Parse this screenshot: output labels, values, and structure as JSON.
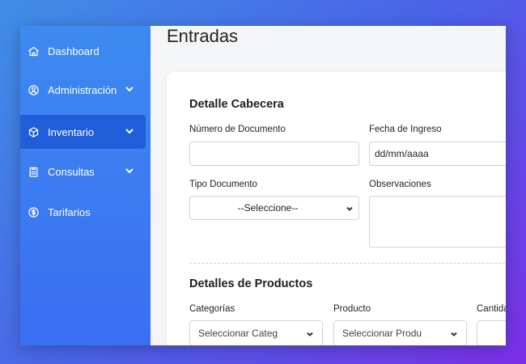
{
  "sidebar": {
    "items": [
      {
        "label": "Dashboard",
        "icon": "home-icon",
        "has_submenu": false,
        "active": false
      },
      {
        "label": "Administración",
        "icon": "user-circle-icon",
        "has_submenu": true,
        "active": false
      },
      {
        "label": "Inventario",
        "icon": "box-icon",
        "has_submenu": true,
        "active": true
      },
      {
        "label": "Consultas",
        "icon": "clipboard-icon",
        "has_submenu": true,
        "active": false
      },
      {
        "label": "Tarifarios",
        "icon": "dollar-circle-icon",
        "has_submenu": false,
        "active": false
      }
    ]
  },
  "main": {
    "title": "Entradas",
    "header_section": {
      "title": "Detalle Cabecera",
      "doc_number_label": "Número de Documento",
      "doc_number_value": "",
      "date_label": "Fecha de Ingreso",
      "date_value": "dd/mm/aaaa",
      "doc_type_label": "Tipo Documento",
      "doc_type_selected": "--Seleccione--",
      "notes_label": "Observaciones",
      "notes_value": ""
    },
    "products_section": {
      "title": "Detalles de Productos",
      "category_label": "Categorías",
      "category_selected": "Seleccionar Categ",
      "product_label": "Producto",
      "product_selected": "Seleccionar Produ",
      "quantity_label": "Cantida",
      "quantity_value": ""
    }
  },
  "colors": {
    "background_gradient_start": "#3f8ee6",
    "background_gradient_end": "#7b2fe8",
    "sidebar": "#3a7cf0",
    "sidebar_active": "#1f5ed8",
    "card": "#ffffff"
  }
}
